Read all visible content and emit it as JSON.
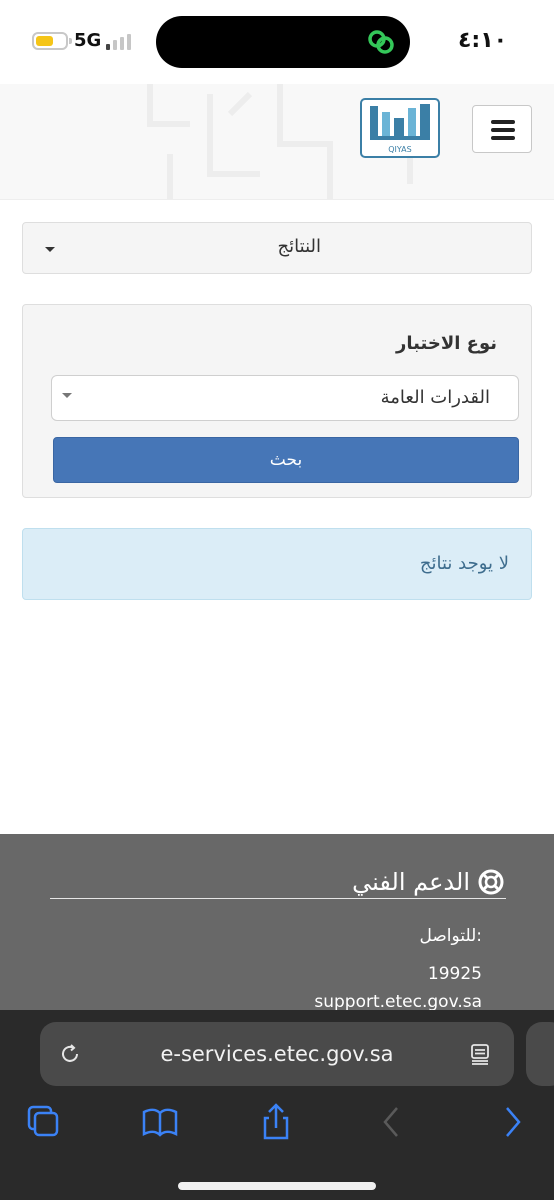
{
  "status_bar": {
    "network": "5G",
    "time": "٤:١٠",
    "battery_level": 0.6
  },
  "header": {
    "logo_text": "QIYAS",
    "menu_icon": "hamburger-menu-icon"
  },
  "results_dropdown": {
    "label": "النتائج"
  },
  "search_form": {
    "field_label": "نوع الاختبار",
    "selected_test": "القدرات العامة",
    "search_button": "بحث"
  },
  "alert": {
    "message": "لا يوجد نتائج"
  },
  "footer": {
    "support_title": "الدعم الفني",
    "contact_label": "للتواصل:",
    "phone": "19925",
    "email": "support.etec.gov.sa"
  },
  "browser": {
    "url": "e-services.etec.gov.sa"
  },
  "colors": {
    "primary_button": "#4676b7",
    "alert_background": "#dbedf7",
    "alert_text": "#3e6d8e",
    "footer_background": "#686868",
    "browser_icon_blue": "#3b82f6",
    "battery_fill": "#f5c518"
  }
}
